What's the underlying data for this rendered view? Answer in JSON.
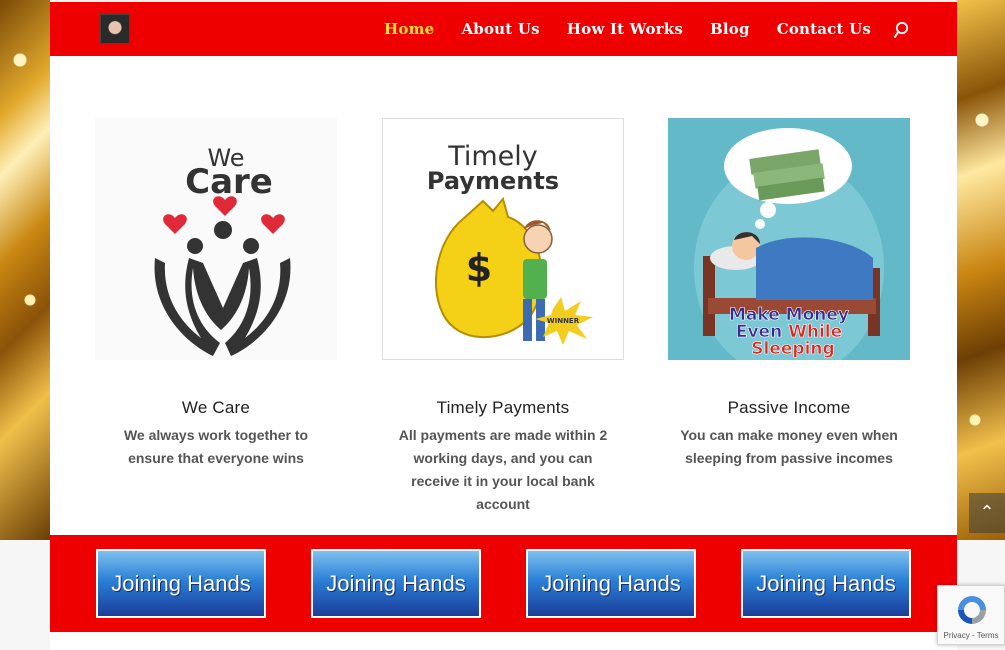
{
  "nav": {
    "items": [
      "Home",
      "About Us",
      "How It Works",
      "Blog",
      "Contact Us"
    ],
    "active": "Home"
  },
  "icons": {
    "search": "search-icon",
    "back_to_top": "chevron-up-icon",
    "logo": "site-logo"
  },
  "features": [
    {
      "image_text_small": "We",
      "image_text_big": "Care",
      "title": "We Care",
      "text": "We always work together to ensure that everyone wins"
    },
    {
      "image_text_small": "Timely",
      "image_text_big": "Payments",
      "image_badge": "WINNER",
      "title": "Timely Payments",
      "text": "All payments are made within 2 working days, and you can receive it in your local bank account"
    },
    {
      "image_text_line1": "Make Money",
      "image_text_line2a": "Even ",
      "image_text_line2b": "While",
      "image_text_line3": "Sleeping",
      "title": "Passive Income",
      "text": "You can make money even when sleeping from passive incomes"
    }
  ],
  "banners": [
    "Joining Hands",
    "Joining Hands",
    "Joining Hands",
    "Joining Hands"
  ],
  "recaptcha": {
    "text": "Privacy - Terms"
  },
  "colors": {
    "header_red": "#ee0000",
    "active_nav": "#ffe12e",
    "banner_blue": "#2b7fd6"
  }
}
